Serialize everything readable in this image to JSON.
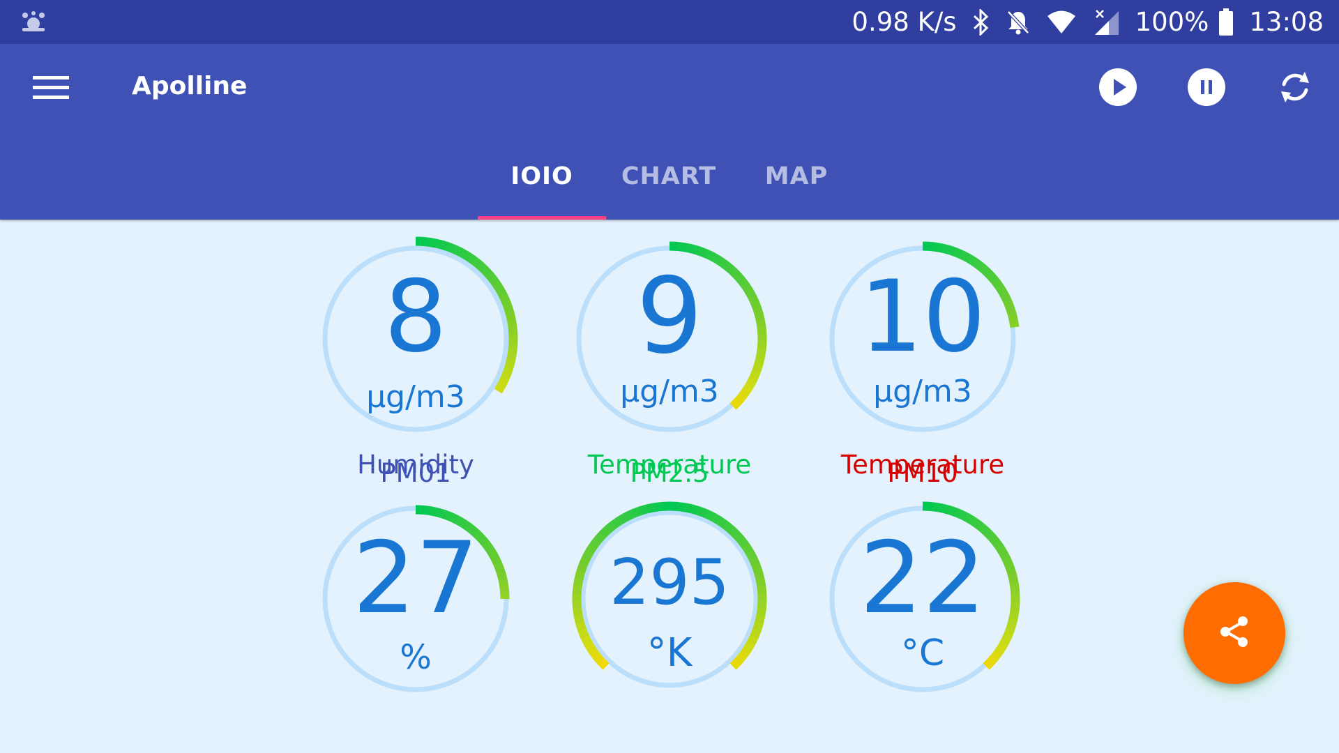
{
  "status_bar": {
    "network_speed": "0.98 K/s",
    "battery": "100%",
    "time": "13:08",
    "icons": [
      "app-notification-icon",
      "bluetooth-icon",
      "notifications-off-icon",
      "wifi-icon",
      "cell-signal-icon",
      "battery-icon"
    ]
  },
  "app_bar": {
    "title": "Apolline",
    "actions": [
      "play-icon",
      "pause-icon",
      "sync-icon"
    ]
  },
  "tabs": [
    {
      "label": "IOIO",
      "active": true
    },
    {
      "label": "CHART",
      "active": false
    },
    {
      "label": "MAP",
      "active": false
    }
  ],
  "colors": {
    "primary_dark": "#303f9f",
    "primary": "#3f51b5",
    "accent": "#ff4081",
    "background": "#e3f2fd",
    "gauge_track": "#bbdefb",
    "value_text": "#1976d2",
    "fab": "#ff6d00"
  },
  "gauges": [
    {
      "value": "8",
      "unit": "µg/m3",
      "label": "PM01",
      "label_color": "#3f51b5",
      "arc_start": 0,
      "arc_end": 0.34
    },
    {
      "value": "9",
      "unit": "µg/m3",
      "label": "PM2.5",
      "label_color": "#00c853",
      "arc_start": 0,
      "arc_end": 0.38
    },
    {
      "value": "10",
      "unit": "µg/m3",
      "label": "PM10",
      "label_color": "#d50000",
      "arc_start": 0,
      "arc_end": 0.23
    },
    {
      "value": "27",
      "unit": "%",
      "label": "Humidity",
      "label_color": "#3f51b5",
      "arc_start": 0,
      "arc_end": 0.25
    },
    {
      "value": "295",
      "unit": "°K",
      "label": "Temperature",
      "label_color": "#00c853",
      "arc_start": -0.38,
      "arc_end": 0.38
    },
    {
      "value": "22",
      "unit": "°C",
      "label": "Temperature",
      "label_color": "#d50000",
      "arc_start": 0,
      "arc_end": 0.38
    }
  ],
  "fab": {
    "icon": "share-icon"
  }
}
